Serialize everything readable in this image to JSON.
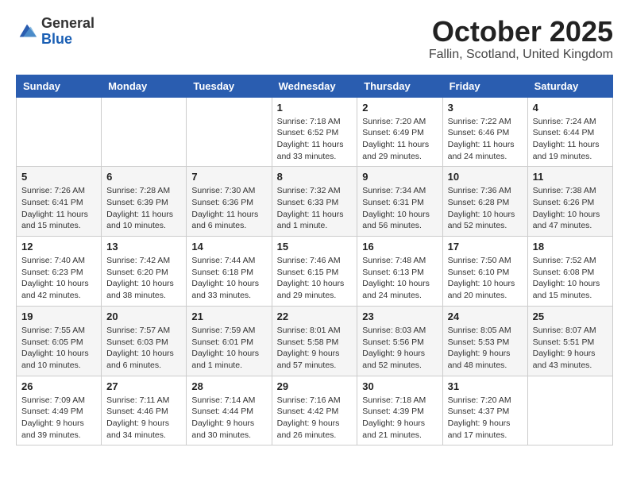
{
  "logo": {
    "general": "General",
    "blue": "Blue"
  },
  "title": "October 2025",
  "subtitle": "Fallin, Scotland, United Kingdom",
  "days_of_week": [
    "Sunday",
    "Monday",
    "Tuesday",
    "Wednesday",
    "Thursday",
    "Friday",
    "Saturday"
  ],
  "weeks": [
    [
      {
        "day": "",
        "info": ""
      },
      {
        "day": "",
        "info": ""
      },
      {
        "day": "",
        "info": ""
      },
      {
        "day": "1",
        "info": "Sunrise: 7:18 AM\nSunset: 6:52 PM\nDaylight: 11 hours and 33 minutes."
      },
      {
        "day": "2",
        "info": "Sunrise: 7:20 AM\nSunset: 6:49 PM\nDaylight: 11 hours and 29 minutes."
      },
      {
        "day": "3",
        "info": "Sunrise: 7:22 AM\nSunset: 6:46 PM\nDaylight: 11 hours and 24 minutes."
      },
      {
        "day": "4",
        "info": "Sunrise: 7:24 AM\nSunset: 6:44 PM\nDaylight: 11 hours and 19 minutes."
      }
    ],
    [
      {
        "day": "5",
        "info": "Sunrise: 7:26 AM\nSunset: 6:41 PM\nDaylight: 11 hours and 15 minutes."
      },
      {
        "day": "6",
        "info": "Sunrise: 7:28 AM\nSunset: 6:39 PM\nDaylight: 11 hours and 10 minutes."
      },
      {
        "day": "7",
        "info": "Sunrise: 7:30 AM\nSunset: 6:36 PM\nDaylight: 11 hours and 6 minutes."
      },
      {
        "day": "8",
        "info": "Sunrise: 7:32 AM\nSunset: 6:33 PM\nDaylight: 11 hours and 1 minute."
      },
      {
        "day": "9",
        "info": "Sunrise: 7:34 AM\nSunset: 6:31 PM\nDaylight: 10 hours and 56 minutes."
      },
      {
        "day": "10",
        "info": "Sunrise: 7:36 AM\nSunset: 6:28 PM\nDaylight: 10 hours and 52 minutes."
      },
      {
        "day": "11",
        "info": "Sunrise: 7:38 AM\nSunset: 6:26 PM\nDaylight: 10 hours and 47 minutes."
      }
    ],
    [
      {
        "day": "12",
        "info": "Sunrise: 7:40 AM\nSunset: 6:23 PM\nDaylight: 10 hours and 42 minutes."
      },
      {
        "day": "13",
        "info": "Sunrise: 7:42 AM\nSunset: 6:20 PM\nDaylight: 10 hours and 38 minutes."
      },
      {
        "day": "14",
        "info": "Sunrise: 7:44 AM\nSunset: 6:18 PM\nDaylight: 10 hours and 33 minutes."
      },
      {
        "day": "15",
        "info": "Sunrise: 7:46 AM\nSunset: 6:15 PM\nDaylight: 10 hours and 29 minutes."
      },
      {
        "day": "16",
        "info": "Sunrise: 7:48 AM\nSunset: 6:13 PM\nDaylight: 10 hours and 24 minutes."
      },
      {
        "day": "17",
        "info": "Sunrise: 7:50 AM\nSunset: 6:10 PM\nDaylight: 10 hours and 20 minutes."
      },
      {
        "day": "18",
        "info": "Sunrise: 7:52 AM\nSunset: 6:08 PM\nDaylight: 10 hours and 15 minutes."
      }
    ],
    [
      {
        "day": "19",
        "info": "Sunrise: 7:55 AM\nSunset: 6:05 PM\nDaylight: 10 hours and 10 minutes."
      },
      {
        "day": "20",
        "info": "Sunrise: 7:57 AM\nSunset: 6:03 PM\nDaylight: 10 hours and 6 minutes."
      },
      {
        "day": "21",
        "info": "Sunrise: 7:59 AM\nSunset: 6:01 PM\nDaylight: 10 hours and 1 minute."
      },
      {
        "day": "22",
        "info": "Sunrise: 8:01 AM\nSunset: 5:58 PM\nDaylight: 9 hours and 57 minutes."
      },
      {
        "day": "23",
        "info": "Sunrise: 8:03 AM\nSunset: 5:56 PM\nDaylight: 9 hours and 52 minutes."
      },
      {
        "day": "24",
        "info": "Sunrise: 8:05 AM\nSunset: 5:53 PM\nDaylight: 9 hours and 48 minutes."
      },
      {
        "day": "25",
        "info": "Sunrise: 8:07 AM\nSunset: 5:51 PM\nDaylight: 9 hours and 43 minutes."
      }
    ],
    [
      {
        "day": "26",
        "info": "Sunrise: 7:09 AM\nSunset: 4:49 PM\nDaylight: 9 hours and 39 minutes."
      },
      {
        "day": "27",
        "info": "Sunrise: 7:11 AM\nSunset: 4:46 PM\nDaylight: 9 hours and 34 minutes."
      },
      {
        "day": "28",
        "info": "Sunrise: 7:14 AM\nSunset: 4:44 PM\nDaylight: 9 hours and 30 minutes."
      },
      {
        "day": "29",
        "info": "Sunrise: 7:16 AM\nSunset: 4:42 PM\nDaylight: 9 hours and 26 minutes."
      },
      {
        "day": "30",
        "info": "Sunrise: 7:18 AM\nSunset: 4:39 PM\nDaylight: 9 hours and 21 minutes."
      },
      {
        "day": "31",
        "info": "Sunrise: 7:20 AM\nSunset: 4:37 PM\nDaylight: 9 hours and 17 minutes."
      },
      {
        "day": "",
        "info": ""
      }
    ]
  ]
}
